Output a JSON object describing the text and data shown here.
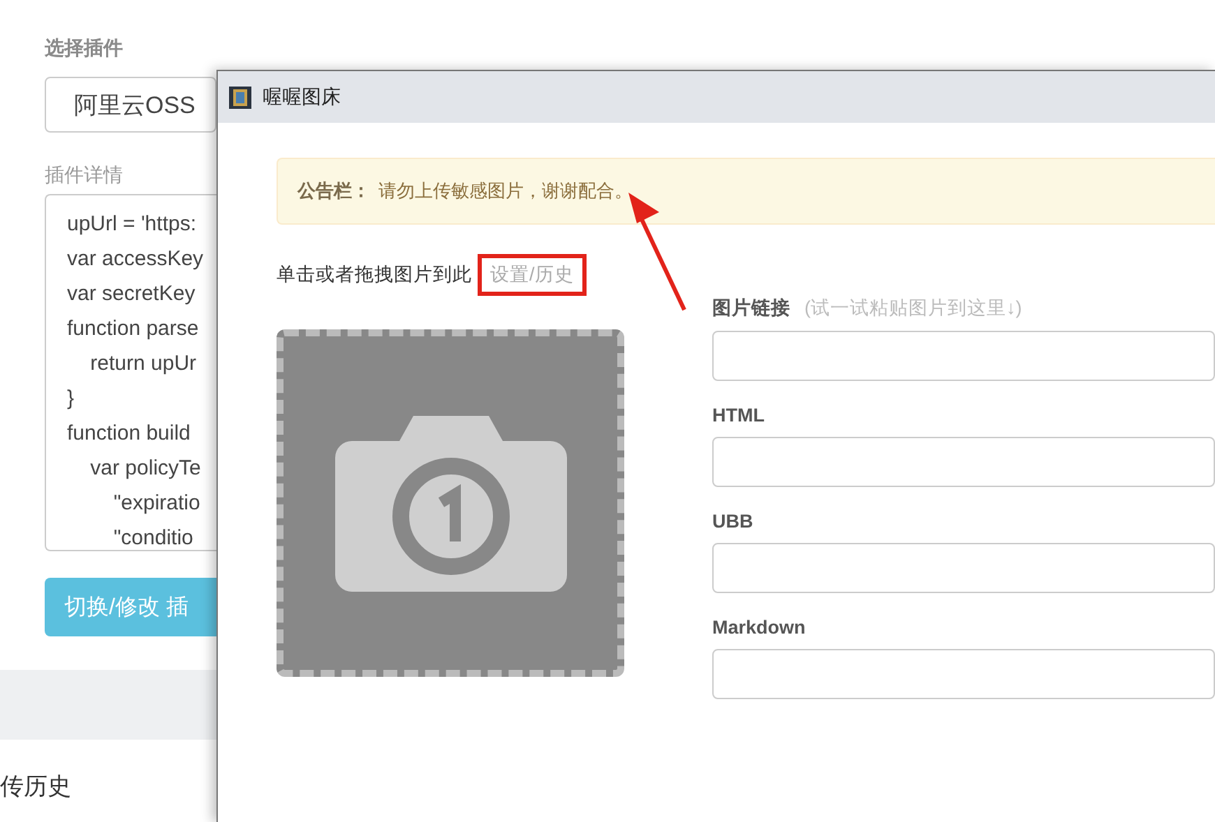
{
  "background_page": {
    "plugin_label": "选择插件",
    "plugin_select": {
      "value": "阿里云OSS"
    },
    "details_label": "插件详情",
    "code_lines": [
      "upUrl = 'https:",
      "var accessKey",
      "var secretKey",
      "function parse",
      "    return upUr",
      "}",
      "function build",
      "    var policyTe",
      "        \"expiratio",
      "        \"conditio"
    ],
    "switch_button": "切换/修改 插",
    "history_heading": "传历史"
  },
  "window": {
    "title": "喔喔图床",
    "notice": {
      "label": "公告栏：",
      "text": "请勿上传敏感图片，谢谢配合。"
    },
    "upload_hint": "单击或者拖拽图片到此",
    "settings_link": {
      "label": "设置/历史",
      "highlighted": true
    },
    "fields": [
      {
        "label": "图片链接",
        "hint": "(试一试粘贴图片到这里↓)"
      },
      {
        "label": "HTML"
      },
      {
        "label": "UBB"
      },
      {
        "label": "Markdown"
      }
    ]
  }
}
